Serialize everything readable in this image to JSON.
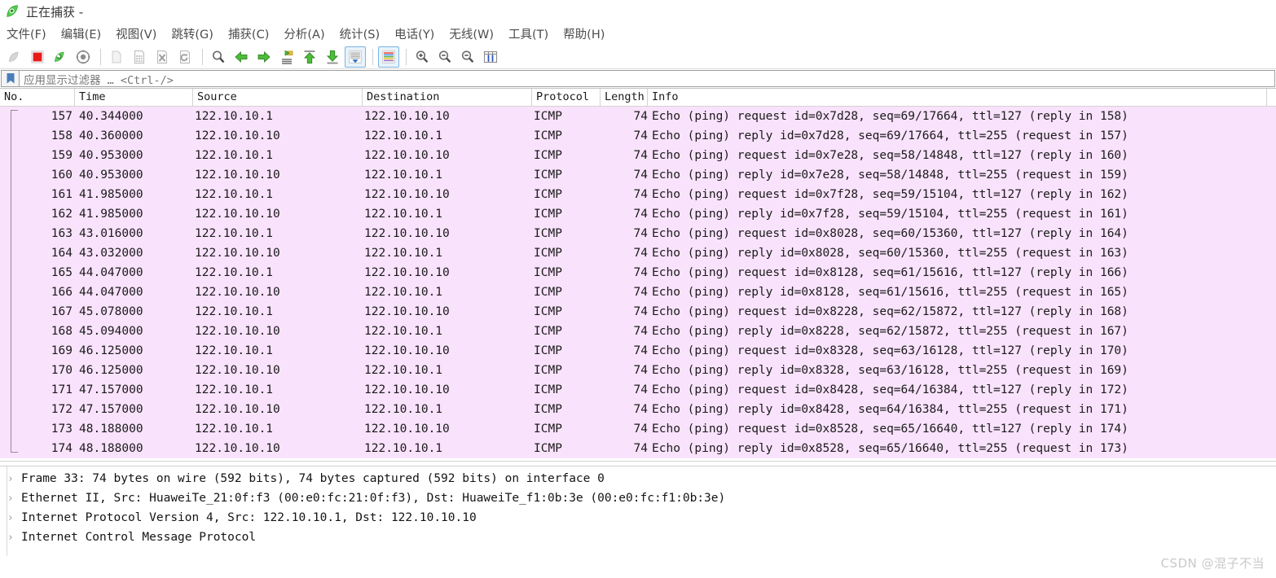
{
  "window": {
    "title": "正在捕获 -",
    "icon": "wireshark-shark-fin-icon"
  },
  "menu": {
    "items": [
      {
        "label": "文件(F)"
      },
      {
        "label": "编辑(E)"
      },
      {
        "label": "视图(V)"
      },
      {
        "label": "跳转(G)"
      },
      {
        "label": "捕获(C)"
      },
      {
        "label": "分析(A)"
      },
      {
        "label": "统计(S)"
      },
      {
        "label": "电话(Y)"
      },
      {
        "label": "无线(W)"
      },
      {
        "label": "工具(T)"
      },
      {
        "label": "帮助(H)"
      }
    ]
  },
  "toolbar": {
    "buttons": [
      {
        "name": "start-capture-icon"
      },
      {
        "name": "stop-capture-icon"
      },
      {
        "name": "restart-capture-icon"
      },
      {
        "name": "capture-options-icon"
      },
      {
        "name": "open-file-icon"
      },
      {
        "name": "save-file-icon"
      },
      {
        "name": "close-file-icon"
      },
      {
        "name": "reload-file-icon"
      },
      {
        "name": "find-packet-icon"
      },
      {
        "name": "go-back-icon"
      },
      {
        "name": "go-forward-icon"
      },
      {
        "name": "go-to-packet-icon"
      },
      {
        "name": "go-to-first-packet-icon"
      },
      {
        "name": "go-to-last-packet-icon"
      },
      {
        "name": "auto-scroll-icon"
      },
      {
        "name": "colorize-packets-icon"
      },
      {
        "name": "zoom-in-icon"
      },
      {
        "name": "zoom-out-icon"
      },
      {
        "name": "zoom-reset-icon"
      },
      {
        "name": "resize-columns-icon"
      }
    ]
  },
  "filter": {
    "bookmark_icon": "bookmark-icon",
    "placeholder": "应用显示过滤器 … <Ctrl-/>",
    "value": ""
  },
  "packet_list": {
    "columns": [
      "No.",
      "Time",
      "Source",
      "Destination",
      "Protocol",
      "Length",
      "Info"
    ],
    "rows": [
      {
        "no": "157",
        "time": "40.344000",
        "src": "122.10.10.1",
        "dst": "122.10.10.10",
        "proto": "ICMP",
        "len": "74",
        "info": "Echo (ping) request  id=0x7d28, seq=69/17664, ttl=127 (reply in 158)"
      },
      {
        "no": "158",
        "time": "40.360000",
        "src": "122.10.10.10",
        "dst": "122.10.10.1",
        "proto": "ICMP",
        "len": "74",
        "info": "Echo (ping) reply    id=0x7d28, seq=69/17664, ttl=255 (request in 157)"
      },
      {
        "no": "159",
        "time": "40.953000",
        "src": "122.10.10.1",
        "dst": "122.10.10.10",
        "proto": "ICMP",
        "len": "74",
        "info": "Echo (ping) request  id=0x7e28, seq=58/14848, ttl=127 (reply in 160)"
      },
      {
        "no": "160",
        "time": "40.953000",
        "src": "122.10.10.10",
        "dst": "122.10.10.1",
        "proto": "ICMP",
        "len": "74",
        "info": "Echo (ping) reply    id=0x7e28, seq=58/14848, ttl=255 (request in 159)"
      },
      {
        "no": "161",
        "time": "41.985000",
        "src": "122.10.10.1",
        "dst": "122.10.10.10",
        "proto": "ICMP",
        "len": "74",
        "info": "Echo (ping) request  id=0x7f28, seq=59/15104, ttl=127 (reply in 162)"
      },
      {
        "no": "162",
        "time": "41.985000",
        "src": "122.10.10.10",
        "dst": "122.10.10.1",
        "proto": "ICMP",
        "len": "74",
        "info": "Echo (ping) reply    id=0x7f28, seq=59/15104, ttl=255 (request in 161)"
      },
      {
        "no": "163",
        "time": "43.016000",
        "src": "122.10.10.1",
        "dst": "122.10.10.10",
        "proto": "ICMP",
        "len": "74",
        "info": "Echo (ping) request  id=0x8028, seq=60/15360, ttl=127 (reply in 164)"
      },
      {
        "no": "164",
        "time": "43.032000",
        "src": "122.10.10.10",
        "dst": "122.10.10.1",
        "proto": "ICMP",
        "len": "74",
        "info": "Echo (ping) reply    id=0x8028, seq=60/15360, ttl=255 (request in 163)"
      },
      {
        "no": "165",
        "time": "44.047000",
        "src": "122.10.10.1",
        "dst": "122.10.10.10",
        "proto": "ICMP",
        "len": "74",
        "info": "Echo (ping) request  id=0x8128, seq=61/15616, ttl=127 (reply in 166)"
      },
      {
        "no": "166",
        "time": "44.047000",
        "src": "122.10.10.10",
        "dst": "122.10.10.1",
        "proto": "ICMP",
        "len": "74",
        "info": "Echo (ping) reply    id=0x8128, seq=61/15616, ttl=255 (request in 165)"
      },
      {
        "no": "167",
        "time": "45.078000",
        "src": "122.10.10.1",
        "dst": "122.10.10.10",
        "proto": "ICMP",
        "len": "74",
        "info": "Echo (ping) request  id=0x8228, seq=62/15872, ttl=127 (reply in 168)"
      },
      {
        "no": "168",
        "time": "45.094000",
        "src": "122.10.10.10",
        "dst": "122.10.10.1",
        "proto": "ICMP",
        "len": "74",
        "info": "Echo (ping) reply    id=0x8228, seq=62/15872, ttl=255 (request in 167)"
      },
      {
        "no": "169",
        "time": "46.125000",
        "src": "122.10.10.1",
        "dst": "122.10.10.10",
        "proto": "ICMP",
        "len": "74",
        "info": "Echo (ping) request  id=0x8328, seq=63/16128, ttl=127 (reply in 170)"
      },
      {
        "no": "170",
        "time": "46.125000",
        "src": "122.10.10.10",
        "dst": "122.10.10.1",
        "proto": "ICMP",
        "len": "74",
        "info": "Echo (ping) reply    id=0x8328, seq=63/16128, ttl=255 (request in 169)"
      },
      {
        "no": "171",
        "time": "47.157000",
        "src": "122.10.10.1",
        "dst": "122.10.10.10",
        "proto": "ICMP",
        "len": "74",
        "info": "Echo (ping) request  id=0x8428, seq=64/16384, ttl=127 (reply in 172)"
      },
      {
        "no": "172",
        "time": "47.157000",
        "src": "122.10.10.10",
        "dst": "122.10.10.1",
        "proto": "ICMP",
        "len": "74",
        "info": "Echo (ping) reply    id=0x8428, seq=64/16384, ttl=255 (request in 171)"
      },
      {
        "no": "173",
        "time": "48.188000",
        "src": "122.10.10.1",
        "dst": "122.10.10.10",
        "proto": "ICMP",
        "len": "74",
        "info": "Echo (ping) request  id=0x8528, seq=65/16640, ttl=127 (reply in 174)"
      },
      {
        "no": "174",
        "time": "48.188000",
        "src": "122.10.10.10",
        "dst": "122.10.10.1",
        "proto": "ICMP",
        "len": "74",
        "info": "Echo (ping) reply    id=0x8528, seq=65/16640, ttl=255 (request in 173)"
      }
    ],
    "row_background_color": "#f9e2fc"
  },
  "packet_detail": {
    "rows": [
      {
        "text": "Frame 33: 74 bytes on wire (592 bits), 74 bytes captured (592 bits) on interface 0"
      },
      {
        "text": "Ethernet II, Src: HuaweiTe_21:0f:f3 (00:e0:fc:21:0f:f3), Dst: HuaweiTe_f1:0b:3e (00:e0:fc:f1:0b:3e)"
      },
      {
        "text": "Internet Protocol Version 4, Src: 122.10.10.1, Dst: 122.10.10.10"
      },
      {
        "text": "Internet Control Message Protocol"
      }
    ],
    "expander_glyph": "›"
  },
  "watermark": {
    "text": "CSDN @混子不当"
  }
}
